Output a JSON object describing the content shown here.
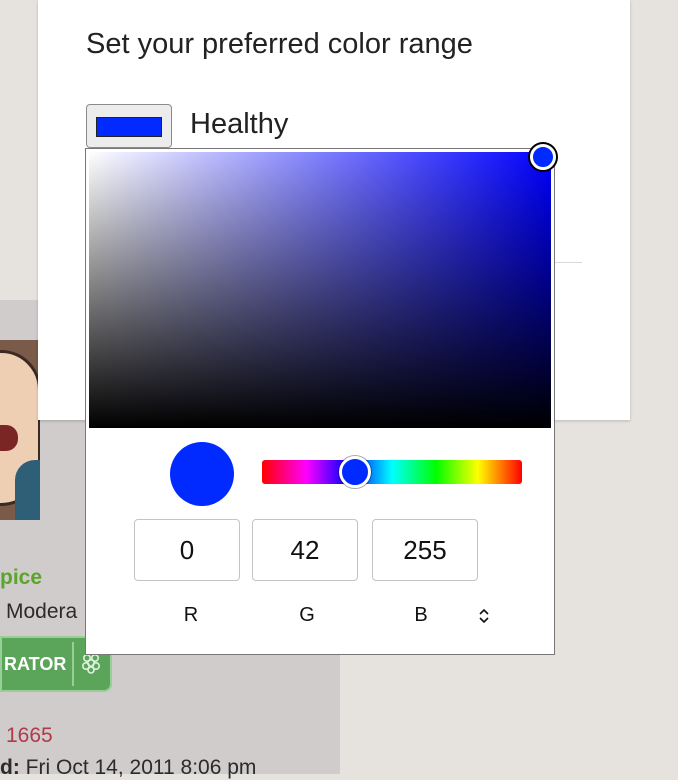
{
  "background_forum": {
    "username_partial": "pice",
    "role_partial": "Modera",
    "badge_partial": "RATOR",
    "posts_partial": "1665",
    "joined_label_partial": "d:",
    "joined_value_partial": "Fri Oct 14, 2011 8:06 pm",
    "icons": {
      "badge_icon": "raspberry-icon"
    }
  },
  "settings": {
    "title": "Set your preferred color range",
    "swatch_label": "Healthy",
    "swatch_color": "#002aff"
  },
  "color_picker": {
    "current_color": "#002aff",
    "hue_color": "#0000ff",
    "hue_position_fraction": 0.356,
    "saturation_fraction": 1.0,
    "value_fraction": 1.0,
    "channels": [
      {
        "label": "R",
        "value": "0"
      },
      {
        "label": "G",
        "value": "42"
      },
      {
        "label": "B",
        "value": "255"
      }
    ],
    "mode_toggle_icon": "up-down-chevron-icon"
  }
}
